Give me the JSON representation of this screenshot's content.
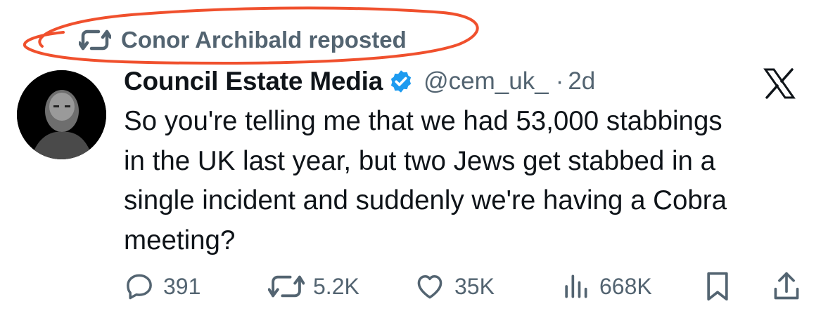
{
  "social_context": {
    "text": "Conor Archibald reposted",
    "icon": "repost-icon"
  },
  "author": {
    "name": "Council Estate Media",
    "handle": "@cem_uk_",
    "separator": "·",
    "time": "2d",
    "verified": true
  },
  "post": {
    "lines": [
      "So you're telling me that we had 53,000 stabbings",
      "in the UK last year, but two Jews get stabbed in a",
      "single incident and suddenly we're having a Cobra",
      "meeting?"
    ]
  },
  "actions": {
    "replies": "391",
    "reposts": "5.2K",
    "likes": "35K",
    "views": "668K"
  },
  "colors": {
    "text": "#0f1419",
    "muted": "#536471",
    "verified": "#1d9bf0",
    "annotation": "#f0502d"
  }
}
